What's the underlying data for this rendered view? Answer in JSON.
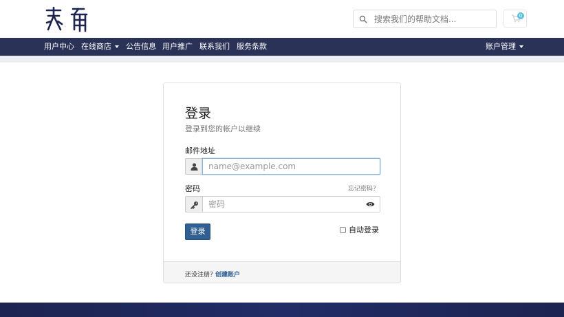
{
  "header": {
    "search": {
      "placeholder": "搜索我们的帮助文档..."
    },
    "cart": {
      "count": "0"
    }
  },
  "nav": {
    "items": [
      {
        "label": "用户中心"
      },
      {
        "label": "在线商店"
      },
      {
        "label": "公告信息"
      },
      {
        "label": "用户推广"
      },
      {
        "label": "联系我们"
      },
      {
        "label": "服务条款"
      }
    ],
    "account": {
      "label": "账户管理"
    }
  },
  "login": {
    "title": "登录",
    "subtitle": "登录到您的帐户以继续",
    "email_label": "邮件地址",
    "email_placeholder": "name@example.com",
    "password_label": "密码",
    "forgot_label": "忘记密码？",
    "password_placeholder": "密码",
    "submit_label": "登录",
    "remember_label": "自动登录",
    "footer_text": "还没注册？",
    "register_link": "创建账户"
  },
  "colors": {
    "nav_bg": "#2a3357",
    "primary_button": "#2f5f93",
    "badge": "#5bc0de"
  }
}
